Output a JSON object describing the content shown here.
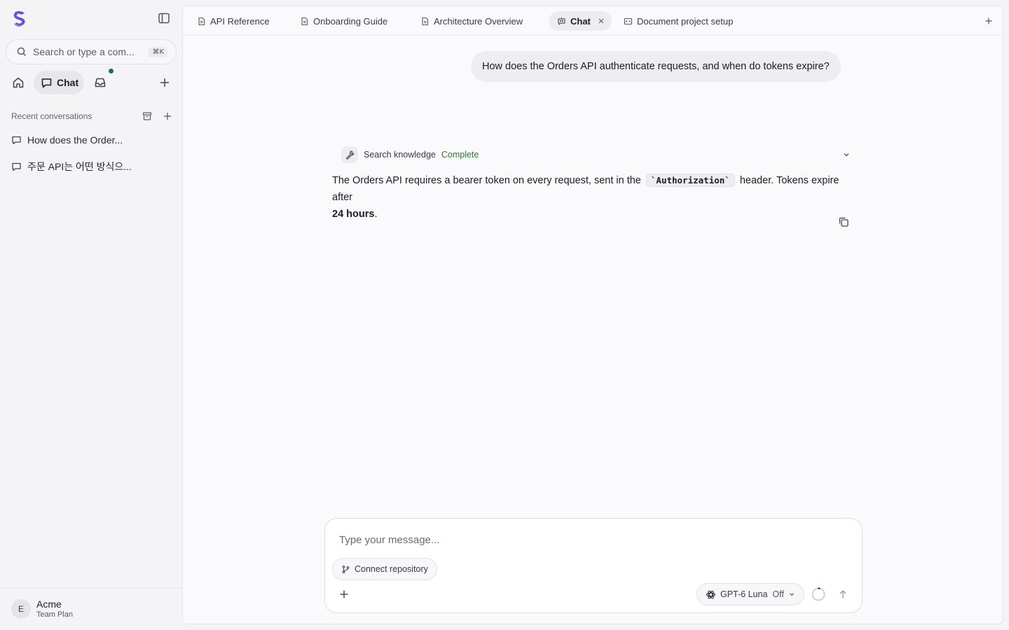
{
  "sidebar": {
    "search_placeholder": "Search or type a com...",
    "search_shortcut": "⌘K",
    "nav": {
      "chat_label": "Chat"
    },
    "recent_title": "Recent conversations",
    "conversations": [
      {
        "label": "How does the Order..."
      },
      {
        "label": "주문 API는 어떤 방식으..."
      }
    ],
    "account": {
      "avatar_initial": "E",
      "name": "Acme",
      "plan": "Team Plan"
    }
  },
  "tabs": [
    {
      "label": "API Reference",
      "icon": "document-icon",
      "active": false
    },
    {
      "label": "Onboarding Guide",
      "icon": "document-icon",
      "active": false
    },
    {
      "label": "Architecture Overview",
      "icon": "document-icon",
      "active": false
    },
    {
      "label": "Chat",
      "icon": "chat-bot-icon",
      "active": true
    },
    {
      "label": "Document project setup",
      "icon": "document-code-icon",
      "active": false
    }
  ],
  "chat": {
    "user_message": "How does the Orders API authenticate requests, and when do tokens expire?",
    "tool": {
      "name": "Search knowledge",
      "status": "Complete"
    },
    "answer": {
      "part1": "The Orders API requires a bearer token on every request, sent in the ",
      "code": "`Authorization`",
      "part2": " header. Tokens expire after ",
      "bold": "24 hours",
      "part3": "."
    }
  },
  "composer": {
    "placeholder": "Type your message...",
    "value": "",
    "repo_button": "Connect repository",
    "model_name": "GPT-6 Luna",
    "model_mode": "Off"
  },
  "colors": {
    "accent_logo": "#6b4fd8",
    "notify_dot": "#17706e",
    "status_complete": "#2f7a34"
  }
}
